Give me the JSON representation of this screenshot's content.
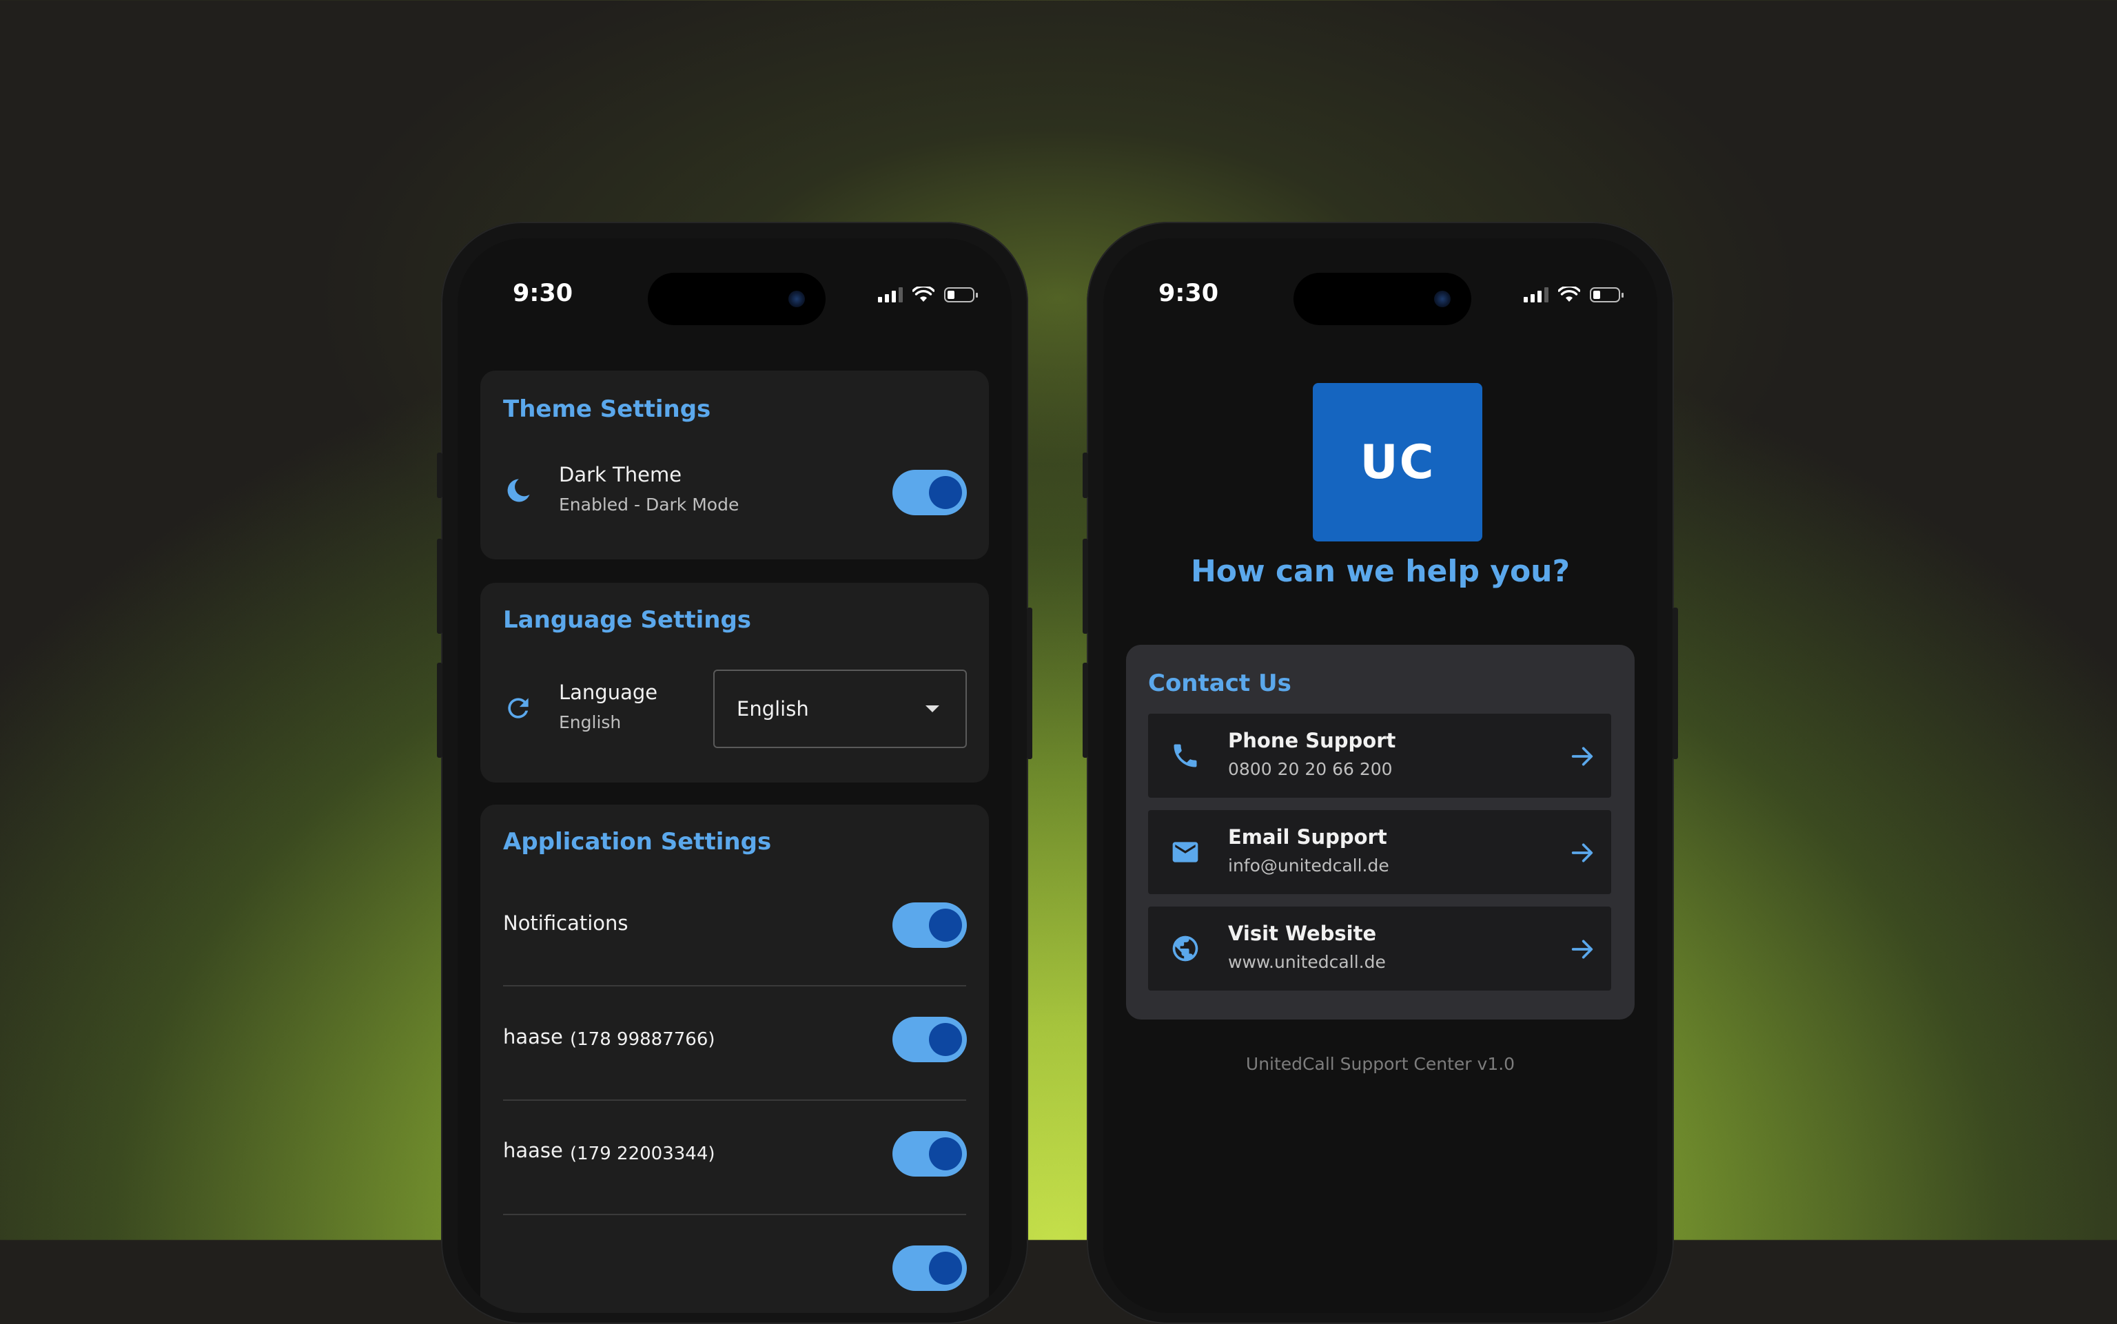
{
  "background": {
    "accent": "#c4df4a",
    "base": "#211f1c"
  },
  "colors": {
    "accent": "#5ba8ec",
    "toggle_knob": "#0d47a1",
    "logo_bg": "#1565c0"
  },
  "left_phone": {
    "status": {
      "time": "9:30"
    },
    "theme_settings": {
      "title": "Theme Settings",
      "dark_theme": {
        "label": "Dark Theme",
        "sublabel": "Enabled - Dark Mode",
        "icon": "moon-icon",
        "enabled": true
      }
    },
    "language_settings": {
      "title": "Language Settings",
      "language": {
        "label": "Language",
        "sublabel": "English",
        "icon": "refresh-icon",
        "selected": "English"
      }
    },
    "application_settings": {
      "title": "Application Settings",
      "notifications": {
        "label": "Notifications",
        "enabled": true
      },
      "lines": [
        {
          "name": "haase",
          "number": "(178 99887766)",
          "enabled": true
        },
        {
          "name": "haase",
          "number": "(179 22003344)",
          "enabled": true
        }
      ]
    }
  },
  "right_phone": {
    "status": {
      "time": "9:30"
    },
    "logo_text": "UC",
    "heading": "How can we help you?",
    "contact": {
      "title": "Contact Us",
      "items": [
        {
          "title": "Phone Support",
          "subtitle": "0800 20 20 66 200",
          "icon": "phone-icon"
        },
        {
          "title": "Email Support",
          "subtitle": "info@unitedcall.de",
          "icon": "mail-icon"
        },
        {
          "title": "Visit Website",
          "subtitle": "www.unitedcall.de",
          "icon": "globe-icon"
        }
      ]
    },
    "footer": "UnitedCall Support Center v1.0"
  }
}
